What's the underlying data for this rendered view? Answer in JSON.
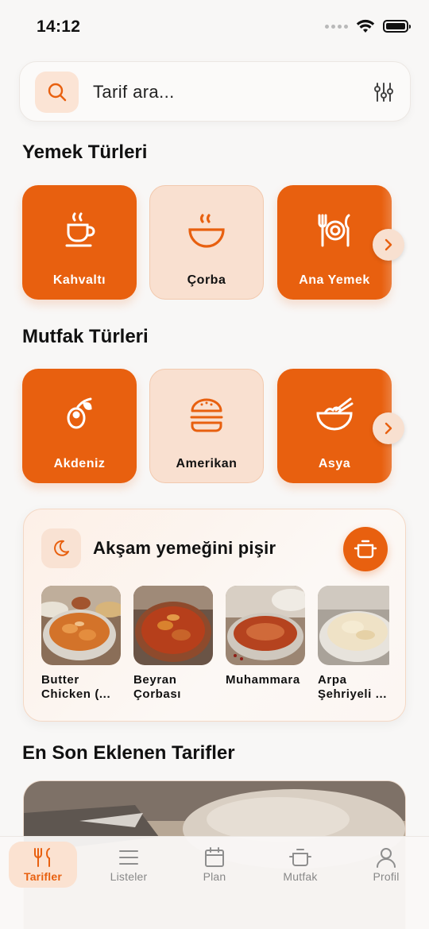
{
  "status_bar": {
    "time": "14:12"
  },
  "search": {
    "placeholder": "Tarif ara..."
  },
  "meal_types": {
    "title": "Yemek Türleri",
    "items": [
      {
        "label": "Kahvaltı",
        "icon": "coffee-cup-icon",
        "style": "solid"
      },
      {
        "label": "Çorba",
        "icon": "soup-bowl-icon",
        "style": "light"
      },
      {
        "label": "Ana Yemek",
        "icon": "plate-cutlery-icon",
        "style": "solid"
      }
    ]
  },
  "cuisine_types": {
    "title": "Mutfak Türleri",
    "items": [
      {
        "label": "Akdeniz",
        "icon": "olive-icon",
        "style": "solid"
      },
      {
        "label": "Amerikan",
        "icon": "burger-icon",
        "style": "light"
      },
      {
        "label": "Asya",
        "icon": "noodle-bowl-icon",
        "style": "solid"
      }
    ]
  },
  "dinner": {
    "title": "Akşam yemeğini pişir",
    "recipes": [
      {
        "name": "Butter Chicken (..."
      },
      {
        "name": "Beyran Çorbası"
      },
      {
        "name": "Muhammara"
      },
      {
        "name": "Arpa Şehriyeli ..."
      }
    ]
  },
  "latest": {
    "title": "En Son Eklenen Tarifler"
  },
  "tabs": [
    {
      "label": "Tarifler",
      "icon": "fork-knife-icon",
      "active": true
    },
    {
      "label": "Listeler",
      "icon": "list-icon",
      "active": false
    },
    {
      "label": "Plan",
      "icon": "calendar-icon",
      "active": false
    },
    {
      "label": "Mutfak",
      "icon": "pot-icon",
      "active": false
    },
    {
      "label": "Profil",
      "icon": "person-icon",
      "active": false
    }
  ],
  "colors": {
    "accent": "#e8600f",
    "accent_light": "#f9e0d0",
    "background": "#f8f7f6"
  }
}
